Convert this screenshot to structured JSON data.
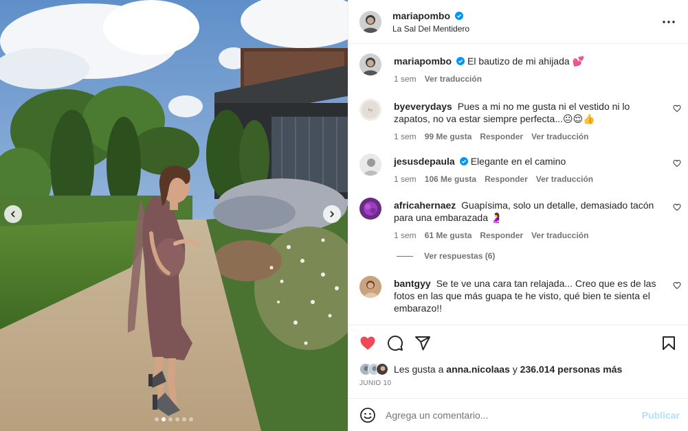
{
  "post": {
    "author": "mariapombo",
    "location": "La Sal Del Mentidero",
    "media": {
      "slide_count": 6,
      "active_slide": 1
    },
    "caption": {
      "username": "mariapombo",
      "text": "El bautizo de mi ahijada 💕",
      "time": "1 sem",
      "translate": "Ver traducción"
    },
    "comments": [
      {
        "username": "byeverydays",
        "text": "Pues a mi no me gusta ni el vestido ni lo zapatos, no va estar siempre perfecta...😐😌👍",
        "time": "1 sem",
        "likes": "99 Me gusta",
        "reply": "Responder",
        "translate": "Ver traducción",
        "verified": false
      },
      {
        "username": "jesusdepaula",
        "text": "Elegante en el camino",
        "time": "1 sem",
        "likes": "106 Me gusta",
        "reply": "Responder",
        "translate": "Ver traducción",
        "verified": true
      },
      {
        "username": "africahernaez",
        "text": "Guapísima, solo un detalle, demasiado tacón para una embarazada 🤰",
        "time": "1 sem",
        "likes": "61 Me gusta",
        "reply": "Responder",
        "translate": "Ver traducción",
        "verified": false
      },
      {
        "username": "bantgyy",
        "text": "Se te ve una cara tan relajada... Creo que es de las fotos en las que más guapa te he visto, qué bien te sienta el embarazo!!",
        "verified": false
      }
    ],
    "view_replies": "Ver respuestas (6)",
    "likes_summary": {
      "prefix": "Les gusta a",
      "first_user": "anna.nicolaas",
      "joiner": "y",
      "others": "236.014 personas más"
    },
    "date": "JUNIO 10",
    "comment_input": {
      "placeholder": "Agrega un comentario...",
      "publish_label": "Publicar"
    }
  },
  "icons": {
    "header_more": "more-horizontal-icon",
    "like": "heart-filled-icon",
    "comment": "comment-icon",
    "share": "send-icon",
    "save": "bookmark-icon",
    "emoji": "emoji-icon",
    "verified": "verified-badge-icon",
    "comment_like": "heart-outline-icon",
    "prev": "chevron-left-icon",
    "next": "chevron-right-icon"
  },
  "colors": {
    "like_red": "#ed4956",
    "verified_blue": "#0095f6",
    "publish_disabled": "#b2dffc",
    "secondary_text": "#737373"
  }
}
